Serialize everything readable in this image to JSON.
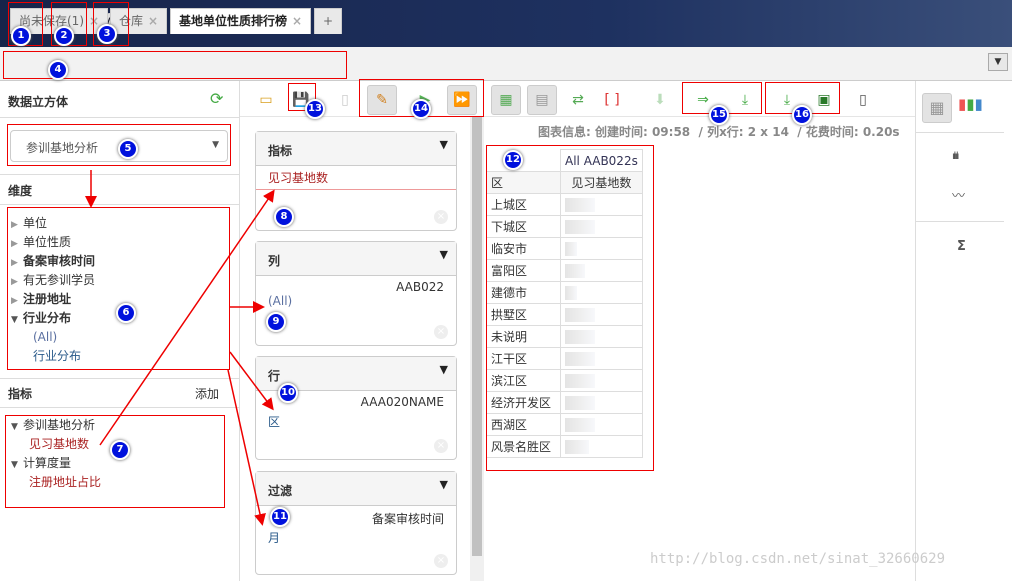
{
  "top_buttons": [
    {
      "name": "new-file"
    },
    {
      "name": "open-folder"
    },
    {
      "name": "about"
    }
  ],
  "tabs": [
    {
      "label": "尚未保存(1)",
      "close": "×"
    },
    {
      "label": "仓库",
      "close": "×"
    },
    {
      "label": "基地单位性质排行榜",
      "close": "×"
    },
    {
      "label": "+"
    }
  ],
  "left": {
    "cube_title": "数据立方体",
    "cube_select": "参训基地分析",
    "dimensions_title": "维度",
    "dimensions": [
      {
        "label": "单位",
        "bold": false
      },
      {
        "label": "单位性质",
        "bold": false
      },
      {
        "label": "备案审核时间",
        "bold": true
      },
      {
        "label": "有无参训学员",
        "bold": false
      },
      {
        "label": "注册地址",
        "bold": true
      },
      {
        "label": "行业分布",
        "bold": true,
        "expanded": true
      }
    ],
    "dim_children": [
      "(All)",
      "行业分布"
    ],
    "measures_title": "指标",
    "add_label": "添加",
    "measure_groups": [
      {
        "label": "参训基地分析",
        "items": [
          "见习基地数"
        ]
      },
      {
        "label": "计算度量",
        "items": [
          "注册地址占比"
        ]
      }
    ]
  },
  "panels": {
    "measures": {
      "title": "指标",
      "item": "见习基地数"
    },
    "columns": {
      "title": "列",
      "dim": "AAB022",
      "level": "(All)"
    },
    "rows": {
      "title": "行",
      "dim": "AAA020NAME",
      "level": "区"
    },
    "filter": {
      "title": "过滤",
      "dim": "备案审核时间",
      "level": "月"
    }
  },
  "info": "图表信息: 创建时间: 09:58  / 列x行: 2 x 14  / 花费时间: 0.20s",
  "table": {
    "col_header": "All AAB022s",
    "row_header": "区",
    "measure": "见习基地数",
    "rows": [
      "上城区",
      "下城区",
      "临安市",
      "富阳区",
      "建德市",
      "拱墅区",
      "未说明",
      "江干区",
      "滨江区",
      "经济开发区",
      "西湖区",
      "风景名胜区"
    ]
  },
  "right_sidebar": {
    "sum": "Σ"
  },
  "annotations": [
    "1",
    "2",
    "3",
    "4",
    "5",
    "6",
    "7",
    "8",
    "9",
    "10",
    "11",
    "12",
    "13",
    "14",
    "15",
    "16"
  ],
  "watermark": "http://blog.csdn.net/sinat_32660629"
}
